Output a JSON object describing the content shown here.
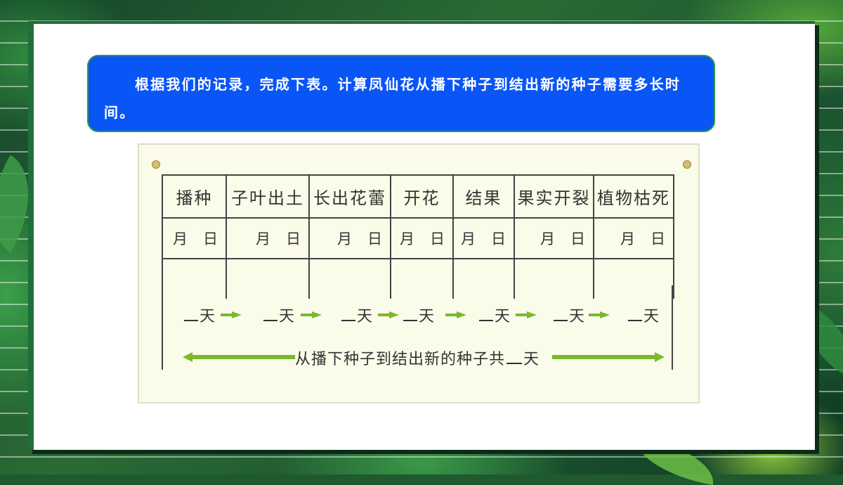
{
  "instruction": "根据我们的记录，完成下表。计算凤仙花从播下种子到结出新的种子需要多长时间。",
  "table": {
    "stages": [
      "播种",
      "子叶出土",
      "长出花蕾",
      "开花",
      "结果",
      "果实开裂",
      "植物枯死"
    ],
    "month_label": "月",
    "day_label": "日"
  },
  "flow": {
    "day_unit": "天",
    "total_prefix": "从播下种子到结出新的种子共",
    "total_unit": "天"
  },
  "colors": {
    "banner": "#0a55f5",
    "arrow": "#7cb82f",
    "frame": "#1f6f3a"
  }
}
